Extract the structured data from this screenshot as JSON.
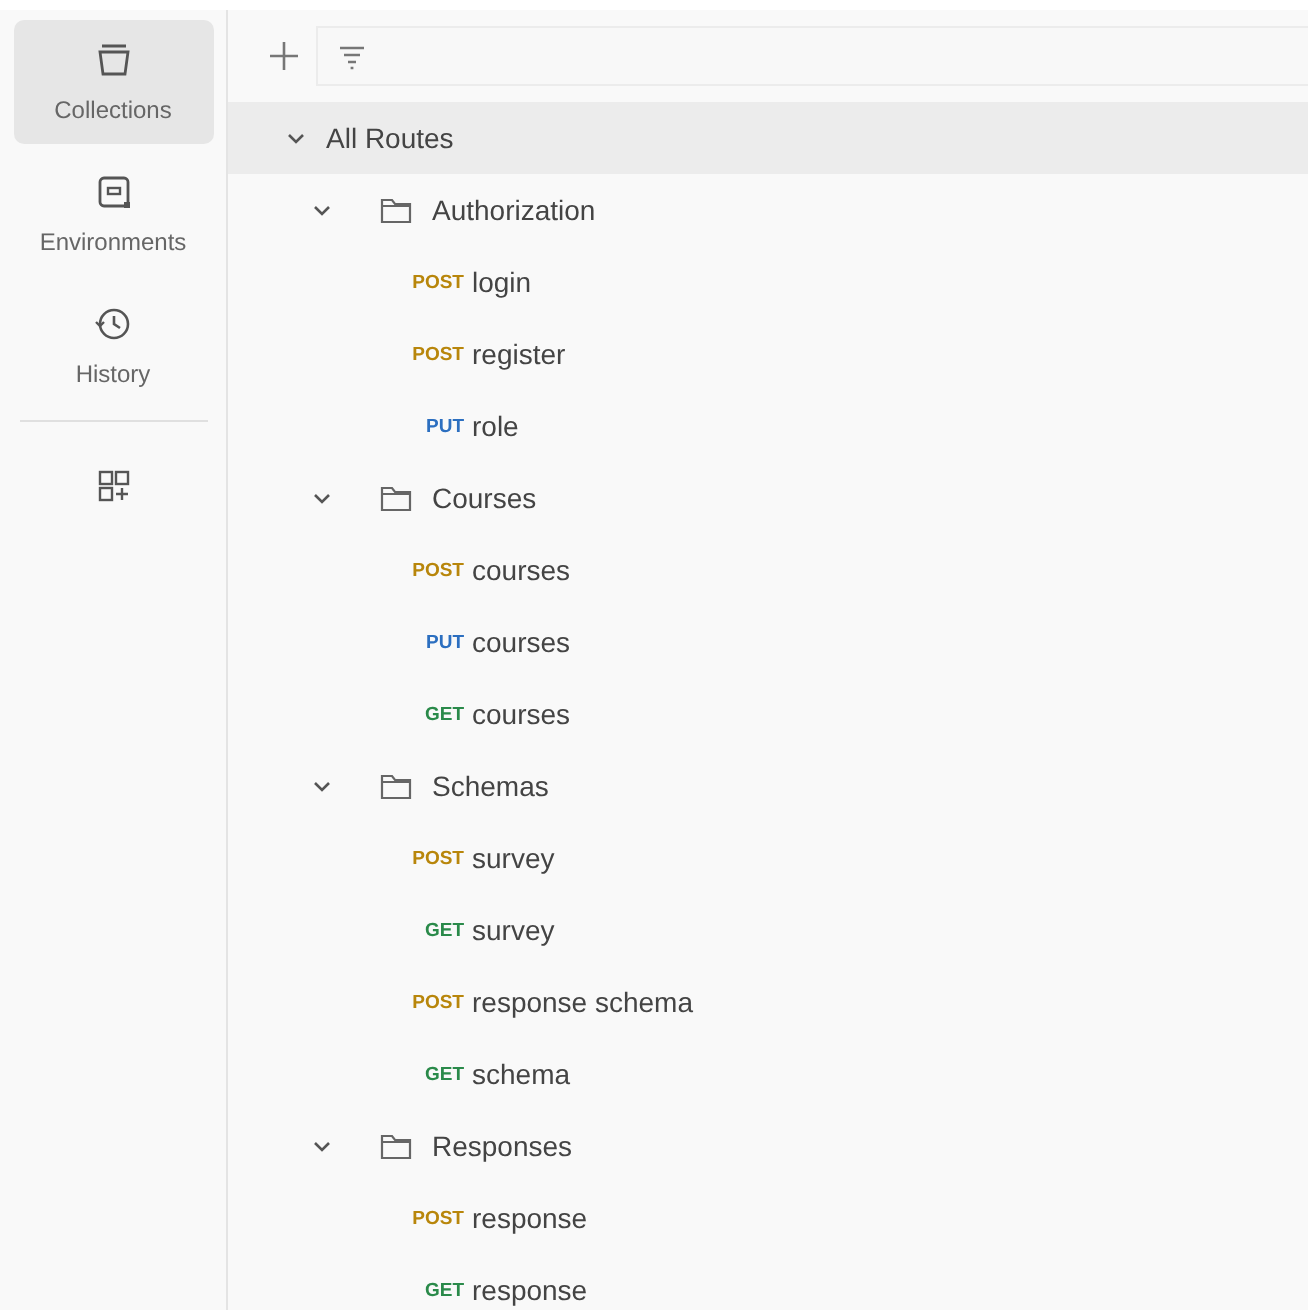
{
  "sidebar": {
    "items": [
      {
        "kind": "collections",
        "label": "Collections",
        "selected": true
      },
      {
        "kind": "environments",
        "label": "Environments",
        "selected": false
      },
      {
        "kind": "history",
        "label": "History",
        "selected": false
      },
      {
        "kind": "add",
        "selected": false
      }
    ]
  },
  "tree": {
    "label": "All Routes",
    "expanded": true,
    "selected": true,
    "children": [
      {
        "label": "Authorization",
        "expanded": true,
        "children": [
          {
            "method": "POST",
            "label": "login"
          },
          {
            "method": "POST",
            "label": "register"
          },
          {
            "method": "PUT",
            "label": "role"
          }
        ]
      },
      {
        "label": "Courses",
        "expanded": true,
        "children": [
          {
            "method": "POST",
            "label": "courses"
          },
          {
            "method": "PUT",
            "label": "courses"
          },
          {
            "method": "GET",
            "label": "courses"
          }
        ]
      },
      {
        "label": "Schemas",
        "expanded": true,
        "children": [
          {
            "method": "POST",
            "label": "survey"
          },
          {
            "method": "GET",
            "label": "survey"
          },
          {
            "method": "POST",
            "label": "response schema"
          },
          {
            "method": "GET",
            "label": "schema"
          }
        ]
      },
      {
        "label": "Responses",
        "expanded": true,
        "children": [
          {
            "method": "POST",
            "label": "response"
          },
          {
            "method": "GET",
            "label": "response"
          }
        ]
      }
    ]
  }
}
